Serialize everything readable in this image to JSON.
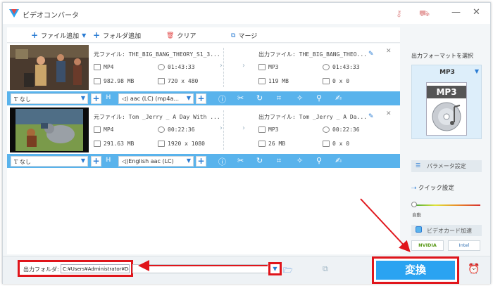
{
  "app": {
    "title": "ビデオコンバータ",
    "brand_color": "#2aa3f1",
    "highlight_color": "#e0151b"
  },
  "toolbar": {
    "add_file": "ファイル追加",
    "add_folder": "フォルダ追加",
    "clear": "クリア",
    "merge": "マージ"
  },
  "files": [
    {
      "source_name": "元ファイル: THE_BIG_BANG_THEORY_S1_3...",
      "format": "MP4",
      "duration": "01:43:33",
      "size": "982.98 MB",
      "resolution": "720 x 480",
      "output_name": "出力ファイル: THE_BIG_BANG_THEO...",
      "out_format": "MP3",
      "out_duration": "01:43:33",
      "out_size": "119 MB",
      "out_resolution": "0 x 0",
      "subtitle": "なし",
      "audio": "aac (LC) (mp4a..."
    },
    {
      "source_name": "元ファイル: Tom _Jerry _ A Day With ...",
      "format": "MP4",
      "duration": "00:22:36",
      "size": "291.63 MB",
      "resolution": "1920 x 1080",
      "output_name": "出力ファイル: Tom _Jerry _ A Da...",
      "out_format": "MP3",
      "out_duration": "00:22:36",
      "out_size": "26 MB",
      "out_resolution": "0 x 0",
      "subtitle": "なし",
      "audio": "English aac (LC)"
    }
  ],
  "right_panel": {
    "format_label": "出力フォーマットを選択",
    "format_name": "MP3",
    "format_icon_text": "MP3",
    "param_button": "パラメータ設定",
    "quick_settings": "クイック設定",
    "quality_label": "自動",
    "gpu_button": "ビデオカード加速",
    "gpu_badges": [
      "NVIDIA",
      "Intel"
    ]
  },
  "bottom": {
    "output_folder_label": "出力フォルダ:",
    "output_path": "C:¥Users¥Administrator¥Desktop",
    "convert_button": "変換"
  }
}
